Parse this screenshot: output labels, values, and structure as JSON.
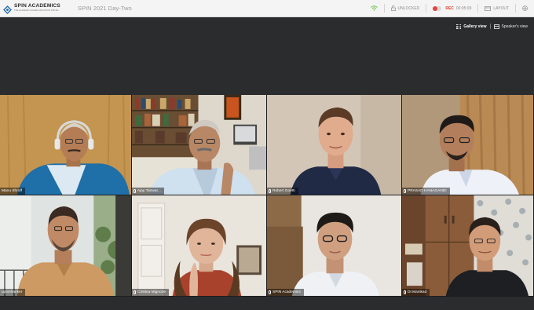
{
  "app": {
    "logo_name": "SPIN ACADEMICS",
    "logo_tagline": "THE ACADEMIC HIGHER EDUCATION PORTAL",
    "meeting_title": "SPIN 2021 Day-Two"
  },
  "toolbar": {
    "wifi_icon": "wifi-icon",
    "lock_label": "UNLOCKED",
    "rec_label": "REC",
    "rec_time": "00:05:09",
    "layout_label": "LAYOUT",
    "globe_icon": "globe-icon",
    "colors": {
      "rec": "#e0443a",
      "bar": "#f4f4f4"
    }
  },
  "view": {
    "gallery_label": "Gallery view",
    "speaker_label": "Speaker's view",
    "active": "gallery"
  },
  "participants": [
    {
      "name": "Manu Shroff"
    },
    {
      "name": "Ajay Tanwar..."
    },
    {
      "name": "Robert Goetti"
    },
    {
      "name": "PRASAD HANAGANDI"
    },
    {
      "name": "uptoshanker"
    },
    {
      "name": "Cristina Mignone"
    },
    {
      "name": "SPIN Academics"
    },
    {
      "name": "Dr.Manikad"
    }
  ]
}
